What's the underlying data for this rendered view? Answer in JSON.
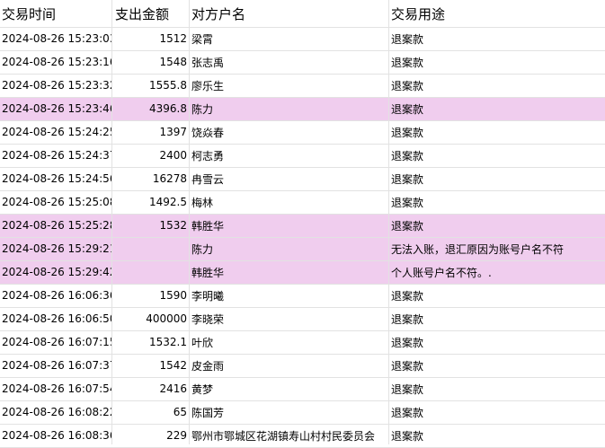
{
  "colors": {
    "highlight": "#f0cdee",
    "grid": "#e2e2e2"
  },
  "headers": {
    "time": "交易时间",
    "amount": "支出金额",
    "name": "对方户名",
    "use": "交易用途"
  },
  "rows": [
    {
      "time": "2024-08-26 15:23:03",
      "amount": "1512",
      "name": "梁霄",
      "use": "退案款",
      "highlight": false
    },
    {
      "time": "2024-08-26 15:23:16",
      "amount": "1548",
      "name": "张志禹",
      "use": "退案款",
      "highlight": false
    },
    {
      "time": "2024-08-26 15:23:32",
      "amount": "1555.8",
      "name": "廖乐生",
      "use": "退案款",
      "highlight": false
    },
    {
      "time": "2024-08-26 15:23:46",
      "amount": "4396.8",
      "name": "陈力",
      "use": "退案款",
      "highlight": true
    },
    {
      "time": "2024-08-26 15:24:25",
      "amount": "1397",
      "name": "饶焱春",
      "use": "退案款",
      "highlight": false
    },
    {
      "time": "2024-08-26 15:24:37",
      "amount": "2400",
      "name": "柯志勇",
      "use": "退案款",
      "highlight": false
    },
    {
      "time": "2024-08-26 15:24:56",
      "amount": "16278",
      "name": "冉雪云",
      "use": "退案款",
      "highlight": false
    },
    {
      "time": "2024-08-26 15:25:08",
      "amount": "1492.5",
      "name": "梅林",
      "use": "退案款",
      "highlight": false
    },
    {
      "time": "2024-08-26 15:25:28",
      "amount": "1532",
      "name": "韩胜华",
      "use": "退案款",
      "highlight": true
    },
    {
      "time": "2024-08-26 15:29:21",
      "amount": "",
      "name": "陈力",
      "use": "无法入账，退汇原因为账号户名不符",
      "highlight": true
    },
    {
      "time": "2024-08-26 15:29:42",
      "amount": "",
      "name": "韩胜华",
      "use": "个人账号户名不符。.",
      "highlight": true
    },
    {
      "time": "2024-08-26 16:06:36",
      "amount": "1590",
      "name": "李明曦",
      "use": "退案款",
      "highlight": false
    },
    {
      "time": "2024-08-26 16:06:50",
      "amount": "400000",
      "name": "李晓荣",
      "use": "退案款",
      "highlight": false
    },
    {
      "time": "2024-08-26 16:07:15",
      "amount": "1532.1",
      "name": "叶欣",
      "use": "退案款",
      "highlight": false
    },
    {
      "time": "2024-08-26 16:07:37",
      "amount": "1542",
      "name": "皮金雨",
      "use": "退案款",
      "highlight": false
    },
    {
      "time": "2024-08-26 16:07:54",
      "amount": "2416",
      "name": "黄梦",
      "use": "退案款",
      "highlight": false
    },
    {
      "time": "2024-08-26 16:08:22",
      "amount": "65",
      "name": "陈国芳",
      "use": "退案款",
      "highlight": false
    },
    {
      "time": "2024-08-26 16:08:36",
      "amount": "229",
      "name": "鄂州市鄂城区花湖镇寿山村村民委员会",
      "use": "退案款",
      "highlight": false
    }
  ]
}
